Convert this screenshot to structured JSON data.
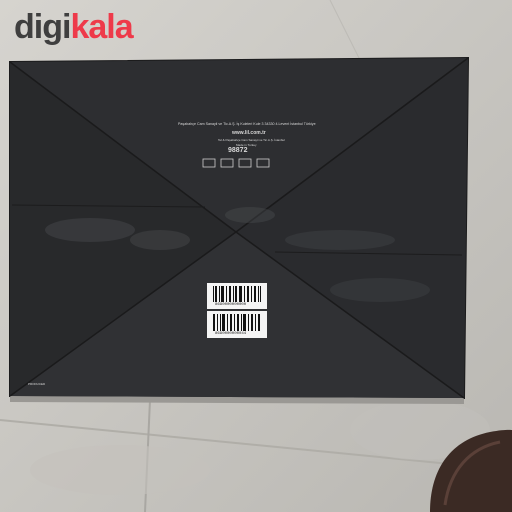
{
  "brand": {
    "part1": "digi",
    "part2": "kala"
  },
  "box": {
    "company_line": "Paşabahçe Cam Sanayii ve Tic.A.Ş. İş Kuleleri Kule 3 34330 4.Levent İstanbul Türkiye",
    "website": "www.lil.com.tr",
    "code": "98872",
    "small_lines": [
      "Tel & Paşabahçe Cam Sanayii ve Tic.A.Ş. İstanbul",
      "Made in Turkey"
    ],
    "barcode_1": "8690000000000",
    "barcode_2": "8690000000044",
    "corner_label": "PRODUCED"
  },
  "colors": {
    "box": "#2b2c2e",
    "floor": "#cfcdc8",
    "brand_accent": "#ee3a4a"
  }
}
